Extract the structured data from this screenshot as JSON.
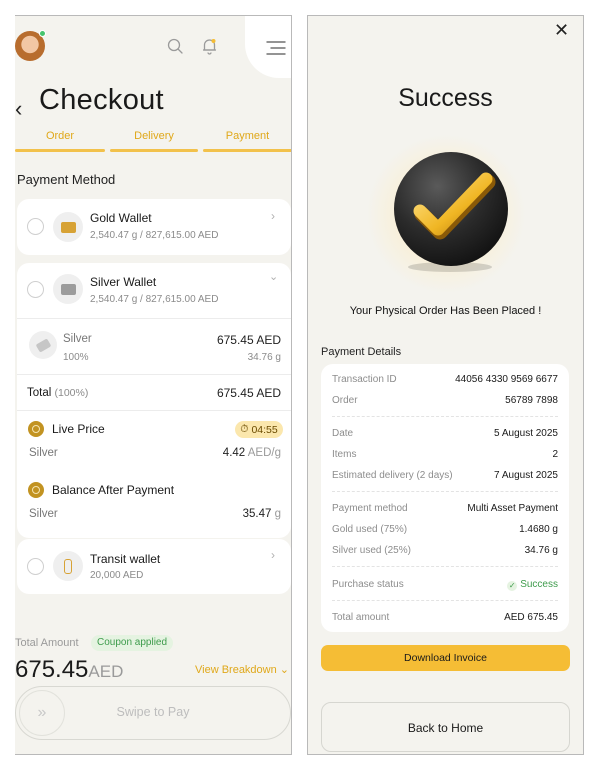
{
  "checkout": {
    "title": "Checkout",
    "steps": [
      "Order",
      "Delivery",
      "Payment"
    ],
    "section_title": "Payment Method",
    "gold_wallet": {
      "name": "Gold Wallet",
      "balance": "2,540.47 g / 827,615.00 AED"
    },
    "silver_wallet": {
      "name": "Silver Wallet",
      "balance": "2,540.47 g / 827,615.00 AED"
    },
    "silver_row": {
      "label": "Silver",
      "amount": "675.45 AED",
      "percent": "100%",
      "weight": "34.76 g"
    },
    "total": {
      "label": "Total",
      "percent": "(100%)",
      "value": "675.45 AED"
    },
    "live_price": {
      "label": "Live Price",
      "timer": "04:55",
      "metal": "Silver",
      "value": "4.42",
      "unit": "AED/g"
    },
    "balance_after": {
      "label": "Balance After Payment",
      "metal": "Silver",
      "value": "35.47",
      "unit": "g"
    },
    "transit_wallet": {
      "name": "Transit wallet",
      "balance": "20,000 AED"
    },
    "total_amount_label": "Total Amount",
    "coupon": "Coupon applied",
    "amount": "675.45",
    "currency": "AED",
    "view_breakdown": "View Breakdown",
    "swipe_label": "Swipe to Pay"
  },
  "success": {
    "title": "Success",
    "message": "Your Physical Order Has Been Placed  !",
    "details_title": "Payment Details",
    "rows": {
      "transaction_id": {
        "label": "Transaction ID",
        "value": "44056 4330 9569 6677"
      },
      "order": {
        "label": "Order",
        "value": "56789 7898"
      },
      "date": {
        "label": "Date",
        "value": "5 August 2025"
      },
      "items": {
        "label": "Items",
        "value": "2"
      },
      "delivery": {
        "label": "Estimated delivery (2 days)",
        "value": "7 August 2025"
      },
      "method": {
        "label": "Payment method",
        "value": "Multi Asset Payment"
      },
      "gold_used": {
        "label": "Gold used (75%)",
        "value": "1.4680 g"
      },
      "silver_used": {
        "label": "Silver used (25%)",
        "value": "34.76 g"
      },
      "status": {
        "label": "Purchase status",
        "value": "Success"
      },
      "total": {
        "label": "Total amount",
        "value": "AED 675.45"
      }
    },
    "download_invoice": "Download Invoice",
    "back_home": "Back to Home"
  },
  "colors": {
    "accent": "#f5bd35",
    "gold_text": "#e0a81a",
    "success_green": "#3e9c4c",
    "background": "#f4f3ee"
  }
}
